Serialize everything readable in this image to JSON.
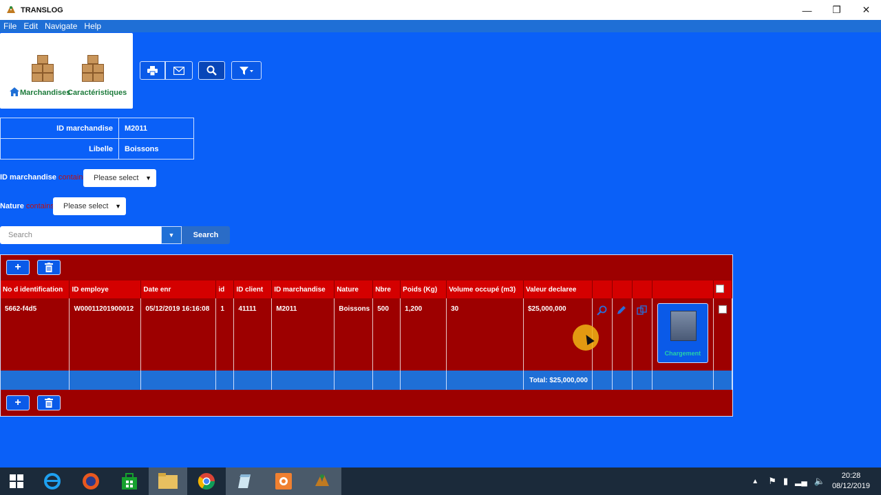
{
  "window": {
    "title": "TRANSLOG",
    "controls": [
      "minimize",
      "restore",
      "close"
    ]
  },
  "menu": [
    "File",
    "Edit",
    "Navigate",
    "Help"
  ],
  "nav": {
    "items": [
      {
        "label": "Marchandises",
        "icon": "home-icon"
      },
      {
        "label": "Caractéristiques"
      }
    ]
  },
  "toolbar": {
    "buttons": [
      "print-icon",
      "mail-icon",
      "search-icon",
      "filter-icon"
    ]
  },
  "record": {
    "fields": [
      {
        "label": "ID marchandise",
        "value": "M2011"
      },
      {
        "label": "Libelle",
        "value": "Boissons"
      }
    ]
  },
  "filters": [
    {
      "label": "ID marchandise",
      "op": "contains",
      "select": "Please select"
    },
    {
      "label": "Nature",
      "op": "contains",
      "select": "Please select"
    }
  ],
  "search": {
    "placeholder": "Search",
    "button": "Search"
  },
  "grid": {
    "columns": [
      "No d identification",
      "ID employe",
      "Date enr",
      "id",
      "ID client",
      "ID marchandise",
      "Nature",
      "Nbre",
      "Poids (Kg)",
      "Volume occupé (m3)",
      "Valeur declaree"
    ],
    "rows": [
      [
        "5662-f4d5",
        "W00011201900012",
        "05/12/2019 16:16:08",
        "1",
        "41111",
        "M2011",
        "Boissons",
        "500",
        "1,200",
        "30",
        "$25,000,000"
      ]
    ],
    "row_action_label": "Chargement",
    "total": "Total: $25,000,000"
  },
  "clock": {
    "time": "20:28",
    "date": "08/12/2019"
  },
  "colors": {
    "background": "#0a60f8",
    "grid": "#9d0000",
    "header": "#d40000"
  }
}
